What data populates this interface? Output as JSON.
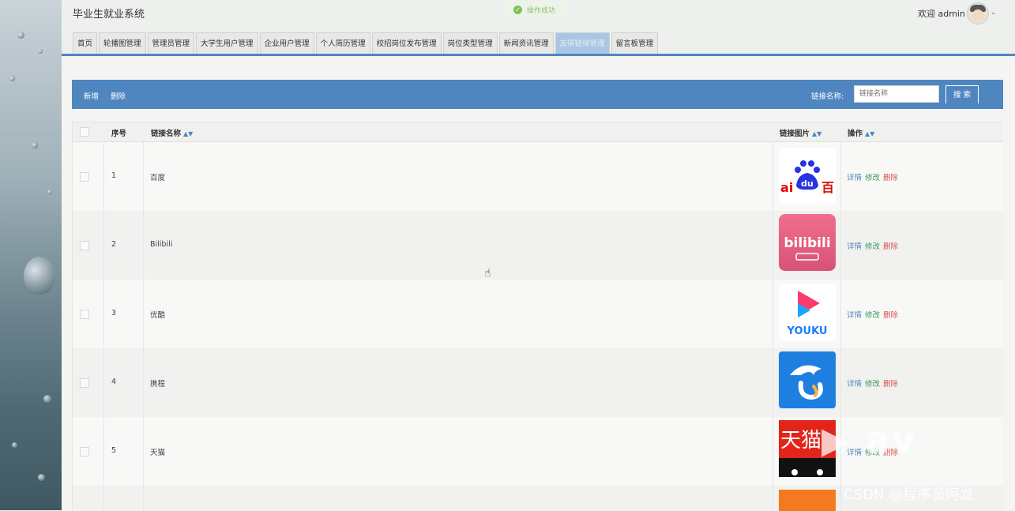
{
  "app": {
    "title": "毕业生就业系统"
  },
  "toast": {
    "text": "操作成功"
  },
  "user": {
    "welcome": "欢迎 admin"
  },
  "tabs": [
    "首页",
    "轮播图管理",
    "管理员管理",
    "大学生用户管理",
    "企业用户管理",
    "个人简历管理",
    "校招岗位发布管理",
    "岗位类型管理",
    "新闻资讯管理",
    "友情链接管理",
    "留言板管理"
  ],
  "active_tab": 9,
  "toolbar": {
    "add": "新增",
    "delete": "删除",
    "search_label": "链接名称:",
    "search_placeholder": "链接名称",
    "search_button": "搜 索"
  },
  "table": {
    "headers": {
      "index": "序号",
      "name": "链接名称",
      "image": "链接图片",
      "ops": "操作"
    },
    "ops": {
      "detail": "详情",
      "edit": "修改",
      "delete": "删除"
    },
    "rows": [
      {
        "index": "1",
        "name": "百度",
        "logo": "baidu-logo"
      },
      {
        "index": "2",
        "name": "Bilibili",
        "logo": "bilibili-logo"
      },
      {
        "index": "3",
        "name": "优酷",
        "logo": "youku-logo"
      },
      {
        "index": "4",
        "name": "携程",
        "logo": "ctrip-logo"
      },
      {
        "index": "5",
        "name": "天猫",
        "logo": "tmall-logo"
      }
    ]
  },
  "logo_text": {
    "baidu_left": "ai",
    "baidu_du": "du",
    "baidu_right": "百",
    "bilibili": "bilibili",
    "youku": "YOUKU",
    "tmall": "天猫"
  },
  "watermarks": {
    "big": "▶ av",
    "csdn": "CSDN @程序员阿龙"
  }
}
